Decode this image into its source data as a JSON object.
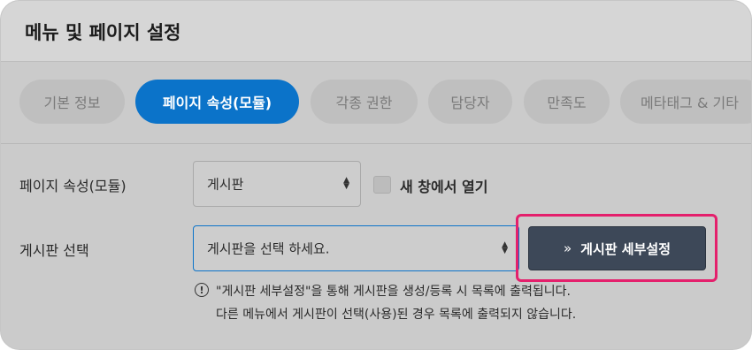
{
  "title": "메뉴 및 페이지 설정",
  "tabs": [
    {
      "label": "기본 정보",
      "active": false
    },
    {
      "label": "페이지 속성(모듈)",
      "active": true
    },
    {
      "label": "각종 권한",
      "active": false
    },
    {
      "label": "담당자",
      "active": false
    },
    {
      "label": "만족도",
      "active": false
    },
    {
      "label": "메타태그 & 기타",
      "active": false
    }
  ],
  "form": {
    "page_attr": {
      "label": "페이지 속성(모듈)",
      "select_value": "게시판",
      "new_window_label": "새 창에서 열기",
      "new_window_checked": false
    },
    "board_select": {
      "label": "게시판 선택",
      "select_value": "게시판을 선택 하세요.",
      "detail_button_icon": "»",
      "detail_button_label": "게시판 세부설정"
    },
    "note": {
      "icon": "!",
      "line1": "\"게시판 세부설정\"을 통해 게시판을 생성/등록 시 목록에 출력됩니다.",
      "line2": "다른 메뉴에서 게시판이 선택(사용)된 경우 목록에 출력되지 않습니다."
    }
  },
  "colors": {
    "active_tab": "#0b73c9",
    "detail_button": "#3d4858",
    "highlight_border": "#e4206c"
  }
}
